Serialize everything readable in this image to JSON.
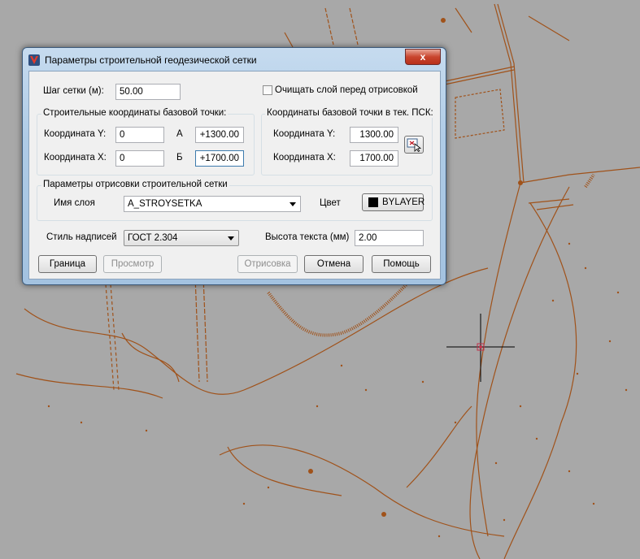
{
  "window": {
    "title": "Параметры строительной геодезической сетки",
    "close_glyph": "x"
  },
  "grid_step": {
    "label": "Шаг сетки (м):",
    "value": "50.00"
  },
  "clear_layer": {
    "label": "Очищать слой перед отрисовкой",
    "checked": false
  },
  "construction_coords": {
    "title": "Строительные координаты базовой точки:",
    "y_label": "Координата Y:",
    "y_value": "0",
    "x_label": "Координата X:",
    "x_value": "0",
    "a_label": "А",
    "a_value": "+1300.00",
    "b_label": "Б",
    "b_value": "+1700.00"
  },
  "ucs_coords": {
    "title": "Координаты базовой точки в тек. ПСК:",
    "y_label": "Координата Y:",
    "y_value": "1300.00",
    "x_label": "Координата X:",
    "x_value": "1700.00"
  },
  "draw_params": {
    "title": "Параметры отрисовки строительной сетки",
    "layer_label": "Имя слоя",
    "layer_value": "A_STROYSETKA",
    "color_label": "Цвет",
    "color_value": "BYLAYER",
    "color_swatch": "#000000"
  },
  "text_style": {
    "label": "Стиль надписей",
    "value": "ГОСТ 2.304"
  },
  "text_height": {
    "label": "Высота текста (мм)",
    "value": "2.00"
  },
  "buttons": {
    "border": "Граница",
    "preview": "Просмотр",
    "draw": "Отрисовка",
    "cancel": "Отмена",
    "help": "Помощь"
  },
  "colors": {
    "cad_background": "#a8a8a8",
    "drawing_lines": "#a0521a",
    "crosshair": "#000000",
    "crosshair_marker": "#c0304a"
  }
}
